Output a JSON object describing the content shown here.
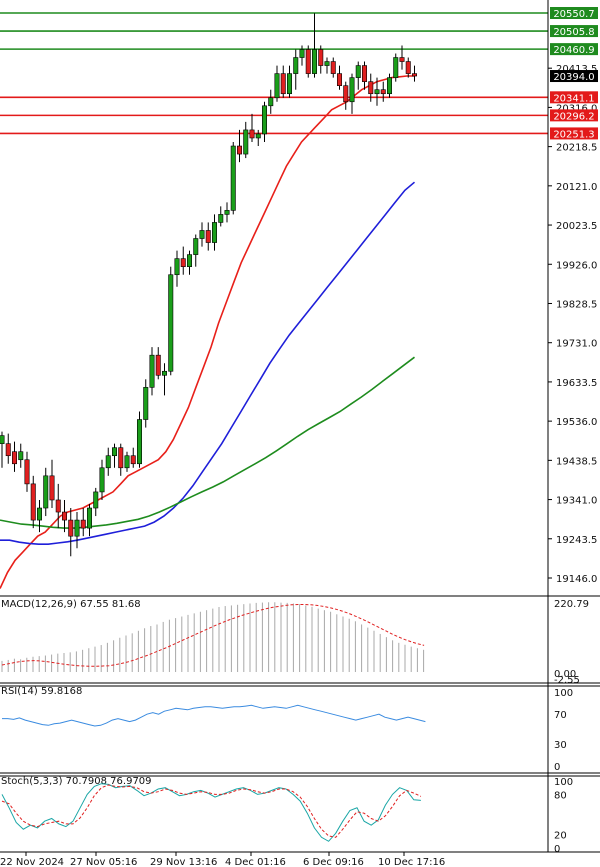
{
  "chart_data": {
    "type": "candlestick",
    "instrument_note": "",
    "price_axis": {
      "min": 19146.0,
      "max": 20550.7,
      "ticks": [
        "20413.5",
        "20316.0",
        "20218.5",
        "20121.0",
        "20023.5",
        "19926.0",
        "19828.5",
        "19731.0",
        "19633.5",
        "19536.0",
        "19438.5",
        "19341.0",
        "19243.5",
        "19146.0"
      ]
    },
    "current_price": "20394.0",
    "resistance_levels": [
      "20550.7",
      "20505.8",
      "20460.9"
    ],
    "support_levels": [
      "20341.1",
      "20296.2",
      "20251.3"
    ],
    "x_tick_labels": [
      "22 Nov 2024",
      "27 Nov 05:16",
      "29 Nov 13:16",
      "4 Dec 01:16",
      "6 Dec 09:16",
      "10 Dec 17:16"
    ],
    "candles": [
      {
        "o": 19480,
        "h": 19510,
        "l": 19420,
        "c": 19500
      },
      {
        "o": 19480,
        "h": 19505,
        "l": 19430,
        "c": 19450
      },
      {
        "o": 19460,
        "h": 19485,
        "l": 19410,
        "c": 19430
      },
      {
        "o": 19440,
        "h": 19480,
        "l": 19420,
        "c": 19460
      },
      {
        "o": 19440,
        "h": 19460,
        "l": 19360,
        "c": 19380
      },
      {
        "o": 19380,
        "h": 19400,
        "l": 19270,
        "c": 19290
      },
      {
        "o": 19290,
        "h": 19340,
        "l": 19260,
        "c": 19320
      },
      {
        "o": 19320,
        "h": 19420,
        "l": 19300,
        "c": 19400
      },
      {
        "o": 19400,
        "h": 19440,
        "l": 19320,
        "c": 19340
      },
      {
        "o": 19340,
        "h": 19380,
        "l": 19270,
        "c": 19310
      },
      {
        "o": 19310,
        "h": 19340,
        "l": 19260,
        "c": 19290
      },
      {
        "o": 19290,
        "h": 19320,
        "l": 19200,
        "c": 19250
      },
      {
        "o": 19250,
        "h": 19310,
        "l": 19220,
        "c": 19290
      },
      {
        "o": 19290,
        "h": 19320,
        "l": 19250,
        "c": 19270
      },
      {
        "o": 19270,
        "h": 19330,
        "l": 19250,
        "c": 19320
      },
      {
        "o": 19320,
        "h": 19370,
        "l": 19300,
        "c": 19360
      },
      {
        "o": 19360,
        "h": 19440,
        "l": 19340,
        "c": 19420
      },
      {
        "o": 19420,
        "h": 19470,
        "l": 19400,
        "c": 19450
      },
      {
        "o": 19450,
        "h": 19480,
        "l": 19420,
        "c": 19470
      },
      {
        "o": 19470,
        "h": 19480,
        "l": 19400,
        "c": 19420
      },
      {
        "o": 19420,
        "h": 19460,
        "l": 19410,
        "c": 19450
      },
      {
        "o": 19450,
        "h": 19470,
        "l": 19420,
        "c": 19430
      },
      {
        "o": 19430,
        "h": 19560,
        "l": 19420,
        "c": 19540
      },
      {
        "o": 19540,
        "h": 19640,
        "l": 19520,
        "c": 19620
      },
      {
        "o": 19620,
        "h": 19720,
        "l": 19600,
        "c": 19700
      },
      {
        "o": 19700,
        "h": 19720,
        "l": 19640,
        "c": 19650
      },
      {
        "o": 19650,
        "h": 19680,
        "l": 19600,
        "c": 19660
      },
      {
        "o": 19660,
        "h": 19920,
        "l": 19650,
        "c": 19900
      },
      {
        "o": 19900,
        "h": 19960,
        "l": 19870,
        "c": 19940
      },
      {
        "o": 19940,
        "h": 19970,
        "l": 19900,
        "c": 19920
      },
      {
        "o": 19920,
        "h": 19960,
        "l": 19900,
        "c": 19950
      },
      {
        "o": 19950,
        "h": 20000,
        "l": 19920,
        "c": 19990
      },
      {
        "o": 19990,
        "h": 20030,
        "l": 19970,
        "c": 20010
      },
      {
        "o": 20010,
        "h": 20030,
        "l": 19960,
        "c": 19980
      },
      {
        "o": 19980,
        "h": 20050,
        "l": 19960,
        "c": 20030
      },
      {
        "o": 20030,
        "h": 20070,
        "l": 20020,
        "c": 20050
      },
      {
        "o": 20050,
        "h": 20080,
        "l": 20030,
        "c": 20060
      },
      {
        "o": 20060,
        "h": 20230,
        "l": 20050,
        "c": 20220
      },
      {
        "o": 20220,
        "h": 20260,
        "l": 20180,
        "c": 20200
      },
      {
        "o": 20200,
        "h": 20280,
        "l": 20190,
        "c": 20260
      },
      {
        "o": 20260,
        "h": 20300,
        "l": 20230,
        "c": 20240
      },
      {
        "o": 20240,
        "h": 20260,
        "l": 20220,
        "c": 20250
      },
      {
        "o": 20250,
        "h": 20330,
        "l": 20230,
        "c": 20320
      },
      {
        "o": 20320,
        "h": 20360,
        "l": 20300,
        "c": 20340
      },
      {
        "o": 20340,
        "h": 20420,
        "l": 20330,
        "c": 20400
      },
      {
        "o": 20400,
        "h": 20420,
        "l": 20340,
        "c": 20350
      },
      {
        "o": 20350,
        "h": 20420,
        "l": 20340,
        "c": 20400
      },
      {
        "o": 20400,
        "h": 20460,
        "l": 20360,
        "c": 20440
      },
      {
        "o": 20440,
        "h": 20470,
        "l": 20420,
        "c": 20460
      },
      {
        "o": 20460,
        "h": 20470,
        "l": 20390,
        "c": 20400
      },
      {
        "o": 20400,
        "h": 20550,
        "l": 20390,
        "c": 20460
      },
      {
        "o": 20460,
        "h": 20470,
        "l": 20400,
        "c": 20420
      },
      {
        "o": 20420,
        "h": 20440,
        "l": 20400,
        "c": 20430
      },
      {
        "o": 20430,
        "h": 20440,
        "l": 20390,
        "c": 20400
      },
      {
        "o": 20400,
        "h": 20420,
        "l": 20360,
        "c": 20370
      },
      {
        "o": 20370,
        "h": 20380,
        "l": 20310,
        "c": 20330
      },
      {
        "o": 20330,
        "h": 20400,
        "l": 20300,
        "c": 20390
      },
      {
        "o": 20390,
        "h": 20430,
        "l": 20360,
        "c": 20420
      },
      {
        "o": 20420,
        "h": 20430,
        "l": 20360,
        "c": 20380
      },
      {
        "o": 20380,
        "h": 20400,
        "l": 20330,
        "c": 20350
      },
      {
        "o": 20350,
        "h": 20390,
        "l": 20320,
        "c": 20360
      },
      {
        "o": 20360,
        "h": 20380,
        "l": 20330,
        "c": 20350
      },
      {
        "o": 20350,
        "h": 20400,
        "l": 20340,
        "c": 20390
      },
      {
        "o": 20390,
        "h": 20450,
        "l": 20380,
        "c": 20440
      },
      {
        "o": 20440,
        "h": 20470,
        "l": 20410,
        "c": 20430
      },
      {
        "o": 20430,
        "h": 20440,
        "l": 20390,
        "c": 20400
      },
      {
        "o": 20400,
        "h": 20420,
        "l": 20380,
        "c": 20394
      }
    ],
    "moving_averages": [
      {
        "color": "#e8201a",
        "values": [
          19120,
          19160,
          19190,
          19210,
          19230,
          19250,
          19260,
          19280,
          19300,
          19310,
          19315,
          19320,
          19330,
          19340,
          19350,
          19360,
          19380,
          19400,
          19410,
          19420,
          19430,
          19440,
          19460,
          19490,
          19530,
          19570,
          19620,
          19670,
          19720,
          19780,
          19830,
          19880,
          19930,
          19970,
          20010,
          20050,
          20090,
          20130,
          20170,
          20200,
          20230,
          20250,
          20270,
          20290,
          20310,
          20320,
          20330,
          20345,
          20360,
          20370,
          20380,
          20385,
          20390,
          20392,
          20394,
          20394
        ]
      },
      {
        "color": "#1f1fd9",
        "values": [
          19240,
          19240,
          19235,
          19232,
          19230,
          19230,
          19233,
          19236,
          19240,
          19245,
          19250,
          19255,
          19260,
          19265,
          19270,
          19275,
          19285,
          19300,
          19320,
          19345,
          19375,
          19410,
          19445,
          19480,
          19520,
          19560,
          19600,
          19640,
          19680,
          19715,
          19750,
          19780,
          19810,
          19840,
          19870,
          19900,
          19930,
          19960,
          19990,
          20020,
          20050,
          20080,
          20110,
          20130
        ]
      },
      {
        "color": "#1e8c1e",
        "values": [
          19290,
          19285,
          19280,
          19278,
          19275,
          19272,
          19270,
          19270,
          19272,
          19275,
          19278,
          19282,
          19287,
          19292,
          19300,
          19310,
          19322,
          19335,
          19348,
          19360,
          19372,
          19385,
          19400,
          19415,
          19430,
          19445,
          19462,
          19480,
          19498,
          19515,
          19530,
          19545,
          19560,
          19578,
          19596,
          19615,
          19635,
          19655,
          19675,
          19695
        ]
      }
    ],
    "macd": {
      "label": "MACD(12,26,9) 67.55 81.68",
      "axis_top": "220.79",
      "axis_bottom_a": "0.00",
      "axis_bottom_b": "-2.55",
      "histogram": [
        35,
        38,
        42,
        40,
        45,
        48,
        50,
        52,
        55,
        58,
        60,
        62,
        65,
        70,
        75,
        80,
        85,
        92,
        100,
        108,
        115,
        122,
        130,
        138,
        145,
        150,
        158,
        165,
        170,
        175,
        180,
        185,
        190,
        195,
        200,
        205,
        208,
        210,
        212,
        214,
        216,
        218,
        219,
        220,
        220,
        219,
        218,
        216,
        214,
        210,
        206,
        200,
        195,
        190,
        182,
        175,
        168,
        160,
        150,
        140,
        130,
        120,
        110,
        100,
        92,
        86,
        80,
        75,
        70,
        68
      ],
      "signal": [
        22,
        26,
        30,
        33,
        35,
        36,
        35,
        33,
        30,
        27,
        24,
        22,
        20,
        19,
        18,
        18,
        19,
        20,
        23,
        27,
        32,
        38,
        45,
        52,
        60,
        68,
        76,
        85,
        94,
        103,
        112,
        121,
        130,
        139,
        148,
        156,
        164,
        171,
        178,
        184,
        190,
        195,
        200,
        204,
        207,
        210,
        212,
        213,
        213,
        212,
        210,
        207,
        203,
        198,
        192,
        185,
        177,
        168,
        159,
        149,
        139,
        129,
        119,
        110,
        102,
        95,
        89,
        84
      ]
    },
    "rsi": {
      "label": "RSI(14) 59.8168",
      "levels": [
        "100",
        "70",
        "30",
        "0"
      ],
      "values": [
        64,
        64,
        63,
        65,
        62,
        60,
        58,
        56,
        55,
        57,
        58,
        60,
        62,
        60,
        58,
        56,
        54,
        55,
        58,
        62,
        64,
        62,
        60,
        62,
        66,
        70,
        72,
        70,
        74,
        76,
        78,
        77,
        76,
        78,
        79,
        80,
        80,
        79,
        78,
        79,
        80,
        80,
        81,
        82,
        80,
        78,
        79,
        80,
        79,
        78,
        80,
        82,
        80,
        78,
        76,
        74,
        72,
        70,
        68,
        66,
        64,
        62,
        64,
        66,
        68,
        70,
        66,
        64,
        62,
        64,
        66,
        64,
        62,
        60
      ]
    },
    "stoch": {
      "label": "Stoch(5,3,3) 70.7908 76.9709",
      "levels": [
        "100",
        "80",
        "20",
        "0"
      ],
      "k": [
        80,
        60,
        38,
        28,
        34,
        30,
        40,
        44,
        36,
        32,
        40,
        60,
        80,
        92,
        96,
        95,
        90,
        92,
        93,
        86,
        78,
        82,
        88,
        90,
        84,
        78,
        80,
        84,
        86,
        82,
        76,
        80,
        84,
        88,
        90,
        86,
        80,
        82,
        86,
        90,
        88,
        80,
        70,
        52,
        30,
        16,
        10,
        22,
        40,
        56,
        60,
        40,
        34,
        42,
        64,
        80,
        90,
        86,
        72,
        71
      ],
      "d": [
        70,
        66,
        52,
        40,
        34,
        32,
        36,
        38,
        40,
        36,
        36,
        45,
        60,
        78,
        90,
        94,
        92,
        91,
        92,
        90,
        84,
        82,
        84,
        88,
        86,
        82,
        80,
        82,
        84,
        83,
        80,
        80,
        82,
        86,
        88,
        87,
        84,
        82,
        84,
        88,
        88,
        84,
        76,
        62,
        44,
        28,
        18,
        16,
        28,
        42,
        54,
        52,
        44,
        40,
        48,
        62,
        78,
        86,
        82,
        77
      ]
    }
  }
}
